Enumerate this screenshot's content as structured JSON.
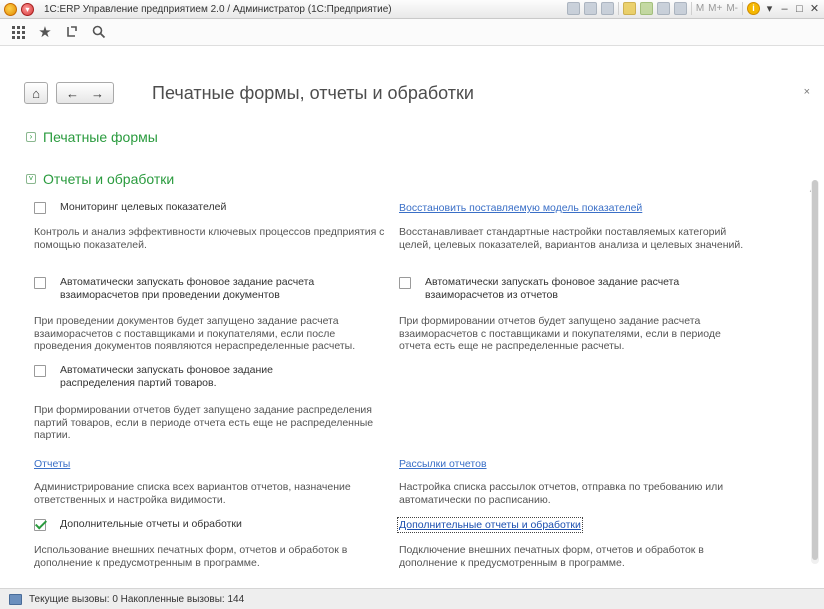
{
  "window": {
    "title": "1С:ERP Управление предприятием 2.0 / Администратор  (1С:Предприятие)",
    "toolbar_text": [
      "M",
      "M+",
      "M-"
    ]
  },
  "app_toolbar": {
    "icons": [
      "apps-grid-icon",
      "star-icon",
      "history-icon",
      "search-icon"
    ]
  },
  "form": {
    "title": "Печатные формы, отчеты и обработки",
    "close": "×"
  },
  "sections": {
    "print_forms": "Печатные формы",
    "reports": "Отчеты и обработки"
  },
  "left": {
    "monitoring_label": "Мониторинг целевых показателей",
    "monitoring_desc": "Контроль и анализ эффективности ключевых процессов предприятия с помощью показателей.",
    "auto_settlement_docs_label": "Автоматически запускать фоновое задание расчета взаиморасчетов при проведении документов",
    "auto_settlement_docs_desc": "При проведении документов будет запущено задание расчета взаиморасчетов с поставщиками и покупателями, если после проведения документов появляются нераспределенные расчеты.",
    "auto_batches_label": "Автоматически запускать фоновое задание распределения партий товаров.",
    "auto_batches_desc": "При формировании отчетов будет запущено задание распределения партий товаров, если в периоде отчета есть еще не распределенные партии.",
    "reports_link": "Отчеты",
    "reports_desc": "Администрирование списка всех вариантов отчетов, назначение ответственных и настройка видимости.",
    "additional_label": "Дополнительные отчеты и обработки",
    "additional_checked": true,
    "additional_desc": "Использование внешних печатных форм, отчетов и обработок в дополнение к предусмотренным в программе."
  },
  "right": {
    "restore_link": "Восстановить поставляемую модель показателей",
    "restore_desc": "Восстанавливает стандартные настройки поставляемых категорий целей, целевых показателей, вариантов анализа и целевых значений.",
    "auto_settlement_reports_label": "Автоматически запускать фоновое задание расчета взаиморасчетов из отчетов",
    "auto_settlement_reports_desc": "При формировании отчетов будет запущено задание расчета взаиморасчетов с поставщиками и покупателями, если в периоде отчета есть еще не распределенные расчеты.",
    "mailing_link": "Рассылки отчетов",
    "mailing_desc": "Настройка списка рассылок отчетов, отправка по требованию или автоматически по расписанию.",
    "additional_link": "Дополнительные отчеты и обработки",
    "additional_link_desc": "Подключение внешних печатных форм, отчетов и обработок в дополнение к предусмотренным в программе."
  },
  "status": {
    "text": "Текущие вызовы: 0   Накопленные вызовы: 144"
  }
}
